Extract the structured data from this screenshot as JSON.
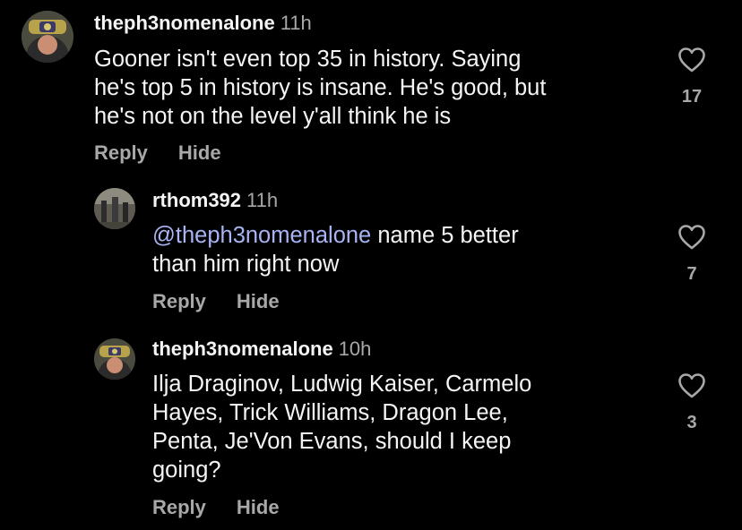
{
  "comments": [
    {
      "username": "theph3nomenalone",
      "time": "11h",
      "text": "Gooner isn't even top 35 in history. Saying\nhe's top 5 in history is insane. He's good, but\nhe's not on the level y'all think he is",
      "reply_label": "Reply",
      "hide_label": "Hide",
      "likes": "17",
      "avatar": "wrestler-championship-avatar"
    },
    {
      "username": "rthom392",
      "time": "11h",
      "mention": "@theph3nomenalone",
      "text": " name 5 better\nthan him right now",
      "reply_label": "Reply",
      "hide_label": "Hide",
      "likes": "7",
      "avatar": "crowd-photo-avatar"
    },
    {
      "username": "theph3nomenalone",
      "time": "10h",
      "text": "Ilja Draginov, Ludwig Kaiser, Carmelo\nHayes, Trick Williams, Dragon Lee,\nPenta, Je'Von Evans, should I keep\ngoing?",
      "reply_label": "Reply",
      "hide_label": "Hide",
      "likes": "3",
      "avatar": "wrestler-championship-avatar"
    }
  ],
  "colors": {
    "background": "#000000",
    "text": "#f5f5f5",
    "secondary": "#a8a8a8",
    "mention": "#a9b4f5"
  },
  "icons": {
    "like": "heart-outline-icon"
  }
}
